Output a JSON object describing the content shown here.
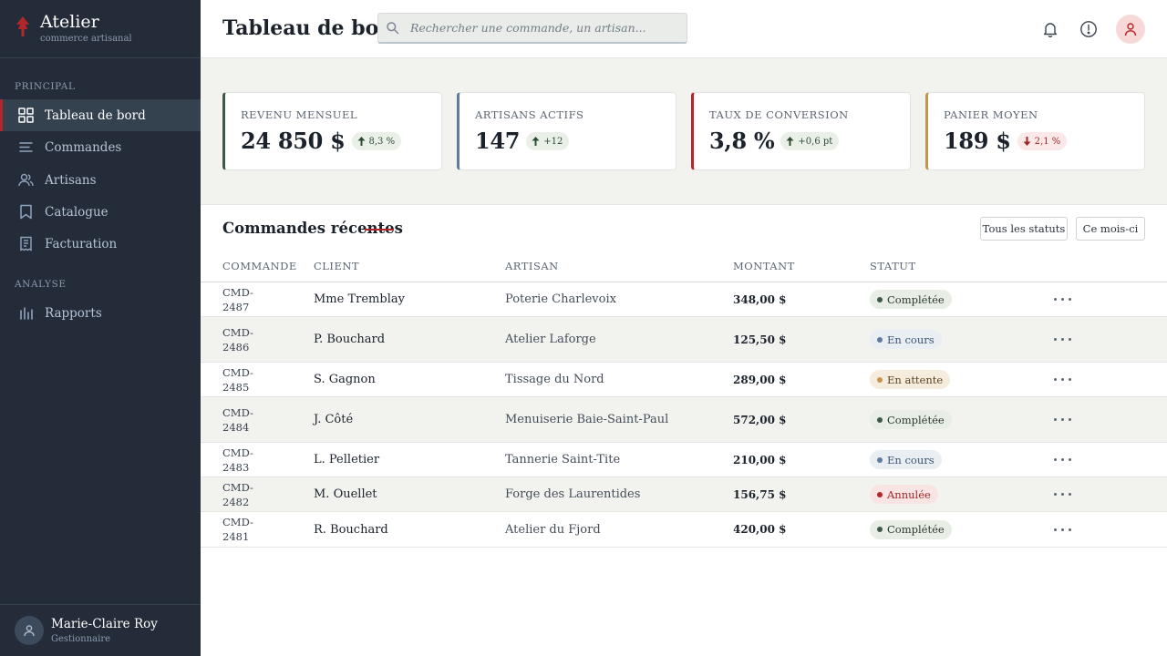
{
  "brand": {
    "name": "Atelier",
    "tagline": "commerce artisanal",
    "color": "#b3262b"
  },
  "sidebar": {
    "sections": [
      {
        "label": "PRINCIPAL"
      },
      {
        "label": "ANALYSE"
      }
    ],
    "items": [
      {
        "label": "Tableau de bord",
        "icon": "grid-icon",
        "active": true
      },
      {
        "label": "Commandes",
        "icon": "list-icon"
      },
      {
        "label": "Artisans",
        "icon": "users-icon"
      },
      {
        "label": "Catalogue",
        "icon": "bookmark-icon"
      },
      {
        "label": "Facturation",
        "icon": "receipt-icon"
      },
      {
        "label": "Rapports",
        "icon": "bar-chart-icon"
      }
    ],
    "user": {
      "name": "Marie-Claire Roy",
      "role": "Gestionnaire"
    }
  },
  "header": {
    "title": "Tableau de bord",
    "search_placeholder": "Rechercher une commande, un artisan...",
    "icons": [
      "bell-icon",
      "alert-icon",
      "user-icon"
    ]
  },
  "kpis": [
    {
      "label": "REVENU MENSUEL",
      "value": "24 850 $",
      "delta": "8,3 %",
      "trend": "up",
      "accent": "#3d5a43"
    },
    {
      "label": "ARTISANS ACTIFS",
      "value": "147",
      "delta": "+12",
      "trend": "up",
      "accent": "#5f7c9b"
    },
    {
      "label": "TAUX DE CONVERSION",
      "value": "3,8 %",
      "delta": "+0,6 pt",
      "trend": "up",
      "accent": "#b3262b"
    },
    {
      "label": "PANIER MOYEN",
      "value": "189 $",
      "delta": "2,1 %",
      "trend": "down",
      "accent": "#c8944b"
    }
  ],
  "orders": {
    "title": "Commandes récentes",
    "filters": {
      "status": "Tous les statuts",
      "period": "Ce mois-ci"
    },
    "columns": [
      "COMMANDE",
      "CLIENT",
      "ARTISAN",
      "MONTANT",
      "STATUT"
    ],
    "rows": [
      {
        "id": "CMD-2487",
        "client": "Mme Tremblay",
        "artisan": "Poterie Charlevoix",
        "amount": "348,00 $",
        "status": "Complétée",
        "kind": "done"
      },
      {
        "id": "CMD-2486",
        "client": "P. Bouchard",
        "artisan": "Atelier Laforge",
        "amount": "125,50 $",
        "status": "En cours",
        "kind": "prog"
      },
      {
        "id": "CMD-2485",
        "client": "S. Gagnon",
        "artisan": "Tissage du Nord",
        "amount": "289,00 $",
        "status": "En attente",
        "kind": "wait"
      },
      {
        "id": "CMD-2484",
        "client": "J. Côté",
        "artisan": "Menuiserie Baie-Saint-Paul",
        "amount": "572,00 $",
        "status": "Complétée",
        "kind": "done"
      },
      {
        "id": "CMD-2483",
        "client": "L. Pelletier",
        "artisan": "Tannerie Saint-Tite",
        "amount": "210,00 $",
        "status": "En cours",
        "kind": "prog"
      },
      {
        "id": "CMD-2482",
        "client": "M. Ouellet",
        "artisan": "Forge des Laurentides",
        "amount": "156,75 $",
        "status": "Annulée",
        "kind": "cancel"
      },
      {
        "id": "CMD-2481",
        "client": "R. Bouchard",
        "artisan": "Atelier du Fjord",
        "amount": "420,00 $",
        "status": "Complétée",
        "kind": "done"
      }
    ]
  }
}
